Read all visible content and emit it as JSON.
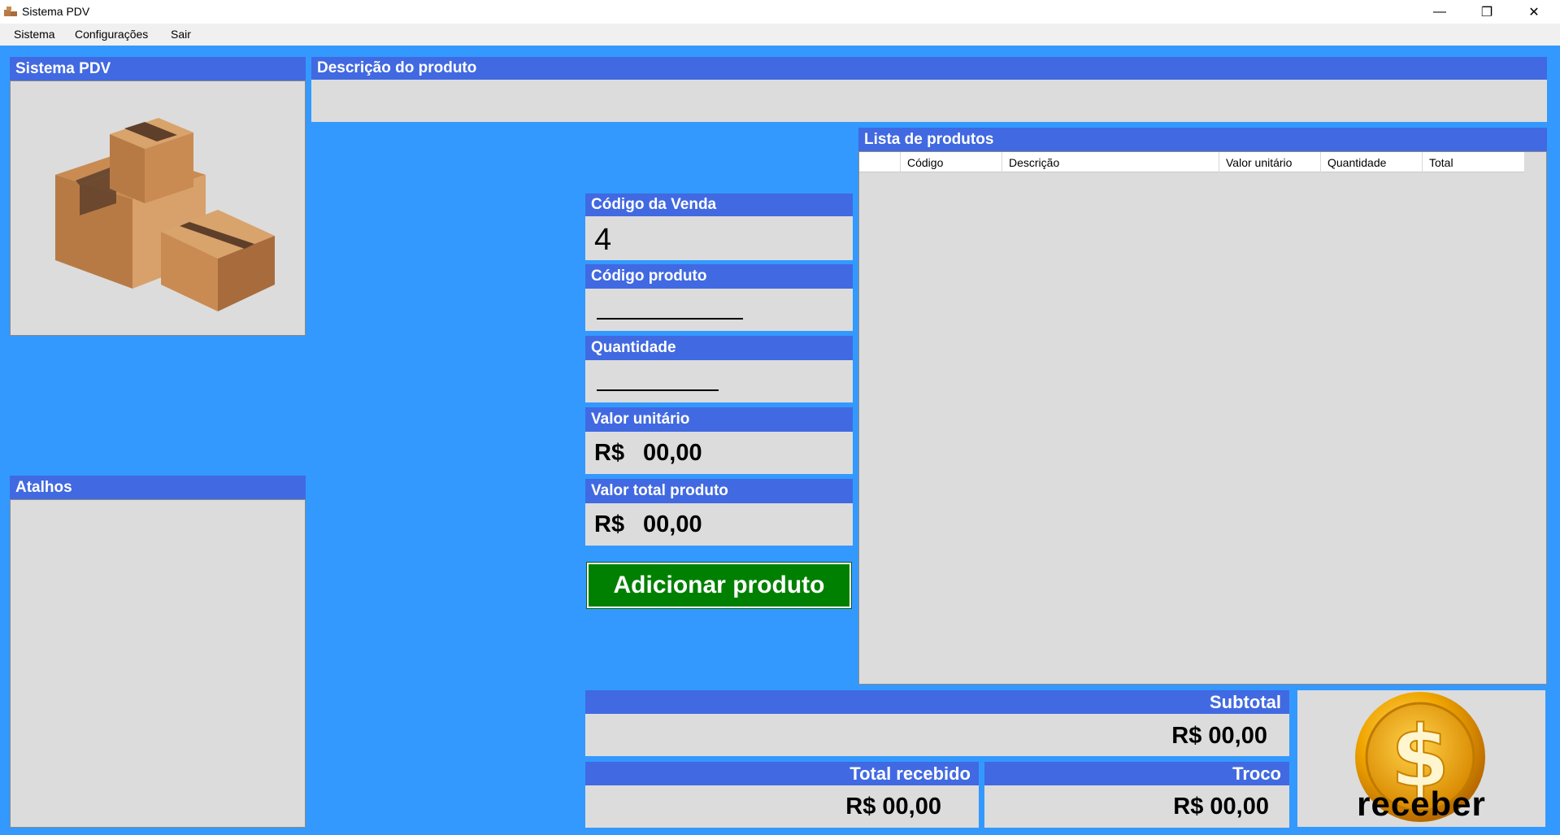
{
  "window": {
    "title": "Sistema PDV",
    "minimize": "—",
    "maximize": "❐",
    "close": "✕"
  },
  "menu": [
    {
      "label": "Sistema"
    },
    {
      "label": "Configurações"
    },
    {
      "label": "Sair"
    }
  ],
  "logo_panel": {
    "header": "Sistema PDV",
    "image": "boxes-icon"
  },
  "shortcuts_panel": {
    "header": "Atalhos"
  },
  "description": {
    "header": "Descrição do produto",
    "value": ""
  },
  "sale": {
    "code_header": "Código da Venda",
    "code_value": "4",
    "product_code_header": "Código produto",
    "quantity_header": "Quantidade",
    "unit_value_header": "Valor unitário",
    "unit_value_currency": "R$",
    "unit_value": "00,00",
    "total_product_header": "Valor total produto",
    "total_product_currency": "R$",
    "total_product_value": "00,00",
    "add_button": "Adicionar produto"
  },
  "product_list": {
    "header": "Lista de produtos",
    "columns": [
      "",
      "Código",
      "Descrição",
      "Valor unitário",
      "Quantidade",
      "Total"
    ],
    "rows": []
  },
  "totals": {
    "subtotal_header": "Subtotal",
    "subtotal_value": "R$ 00,00",
    "received_header": "Total recebido",
    "received_value": "R$ 00,00",
    "change_header": "Troco",
    "change_value": "R$ 00,00",
    "receive_button": "receber",
    "receive_icon": "dollar-coin-icon"
  },
  "colors": {
    "background": "#3399ff",
    "header": "#4169e1",
    "field": "#dcdcdc",
    "add_button": "#008000",
    "coin": "#f0a500"
  }
}
